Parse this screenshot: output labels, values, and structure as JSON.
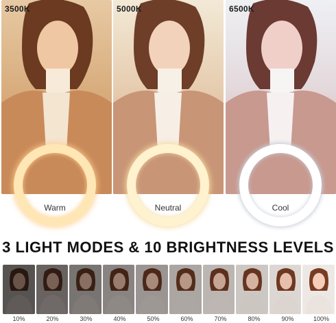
{
  "panels": [
    {
      "temp": "3500K",
      "caption": "Warm"
    },
    {
      "temp": "5000K",
      "caption": "Neutral"
    },
    {
      "temp": "6500K",
      "caption": "Cool"
    }
  ],
  "headline": "3 LIGHT MODES & 10 BRIGHTNESS LEVELS",
  "brightness_levels": [
    "10%",
    "20%",
    "30%",
    "40%",
    "50%",
    "60%",
    "70%",
    "80%",
    "90%",
    "100%"
  ],
  "brightness_values": [
    10,
    20,
    30,
    40,
    50,
    60,
    70,
    80,
    90,
    100
  ],
  "colors": {
    "warm": "#ffe6b5",
    "neutral": "#fff2cf",
    "cool": "#ffffff"
  }
}
